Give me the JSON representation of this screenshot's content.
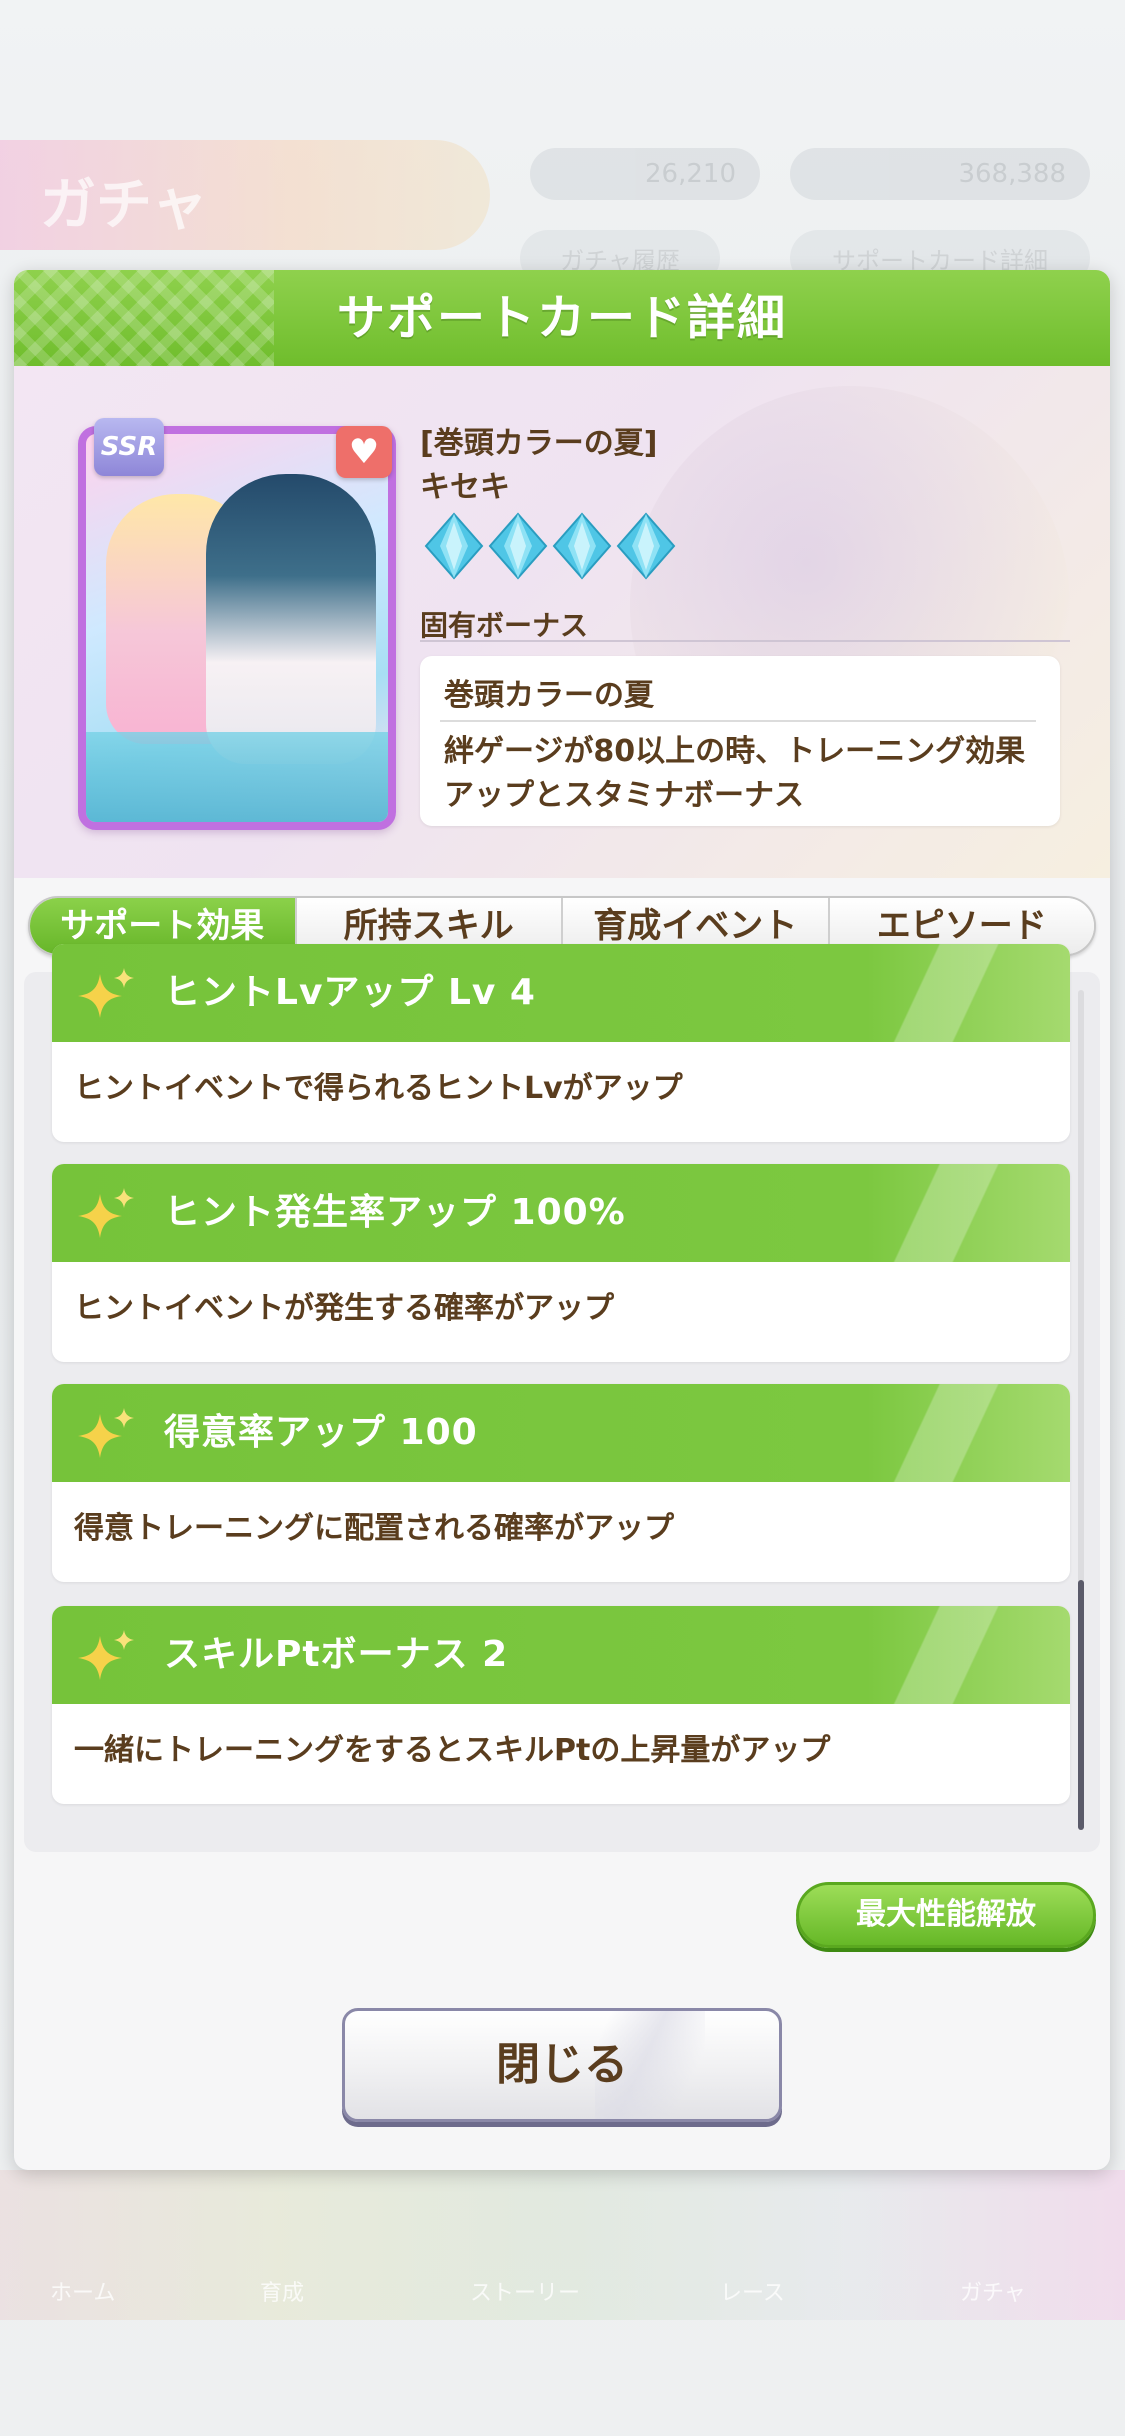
{
  "background": {
    "header_title": "ガチャ",
    "currency_1": "26,210",
    "currency_2": "368,388",
    "sub_buttons": [
      "ガチャ履歴",
      "サポートカード詳細"
    ],
    "footer_labels": [
      "ホーム",
      "育成",
      "ストーリー",
      "レース",
      "ガチャ"
    ]
  },
  "dialog": {
    "title": "サポートカード詳細",
    "card": {
      "rarity": "SSR",
      "title": "[巻頭カラーの夏]",
      "name": "キセキ",
      "gem_count": 4,
      "gem_color": "#4fc6e6",
      "favorite_icon": "heart-icon"
    },
    "unique_bonus": {
      "label": "固有ボーナス",
      "name": "巻頭カラーの夏",
      "description": "絆ゲージが80以上の時、トレーニング効果アップとスタミナボーナス"
    },
    "tabs": [
      {
        "label": "サポート効果",
        "active": true
      },
      {
        "label": "所持スキル",
        "active": false
      },
      {
        "label": "育成イベント",
        "active": false
      },
      {
        "label": "エピソード",
        "active": false
      }
    ],
    "effects": [
      {
        "title": "ヒントLvアップ Lv 4",
        "description": "ヒントイベントで得られるヒントLvがアップ"
      },
      {
        "title": "ヒント発生率アップ 100%",
        "description": "ヒントイベントが発生する確率がアップ"
      },
      {
        "title": "得意率アップ 100",
        "description": "得意トレーニングに配置される確率がアップ"
      },
      {
        "title": "スキルPtボーナス 2",
        "description": "一緒にトレーニングをするとスキルPtの上昇量がアップ"
      }
    ],
    "max_performance_button": "最大性能解放",
    "close_button": "閉じる"
  },
  "colors": {
    "accent_green": "#76c33a",
    "text_brown": "#5a3d1e",
    "card_frame": "#c070e0"
  }
}
